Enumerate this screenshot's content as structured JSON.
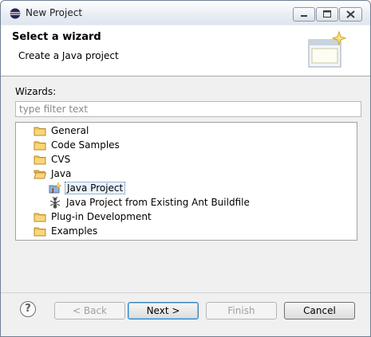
{
  "window": {
    "title": "New Project",
    "icon": "eclipse-icon"
  },
  "header": {
    "title": "Select a wizard",
    "description": "Create a Java project",
    "banner_icon": "new-wizard-banner-icon"
  },
  "wizards": {
    "label": "Wizards:",
    "filter_placeholder": "type filter text",
    "filter_value": ""
  },
  "tree": [
    {
      "label": "General",
      "icon": "folder-icon",
      "level": 0,
      "selected": false
    },
    {
      "label": "Code Samples",
      "icon": "folder-icon",
      "level": 0,
      "selected": false
    },
    {
      "label": "CVS",
      "icon": "folder-icon",
      "level": 0,
      "selected": false
    },
    {
      "label": "Java",
      "icon": "folder-open-icon",
      "level": 0,
      "selected": false
    },
    {
      "label": "Java Project",
      "icon": "java-project-icon",
      "level": 1,
      "selected": true
    },
    {
      "label": "Java Project from Existing Ant Buildfile",
      "icon": "ant-icon",
      "level": 1,
      "selected": false
    },
    {
      "label": "Plug-in Development",
      "icon": "folder-icon",
      "level": 0,
      "selected": false
    },
    {
      "label": "Examples",
      "icon": "folder-icon",
      "level": 0,
      "selected": false
    }
  ],
  "footer": {
    "help": "?",
    "back": "< Back",
    "next": "Next >",
    "finish": "Finish",
    "cancel": "Cancel"
  }
}
